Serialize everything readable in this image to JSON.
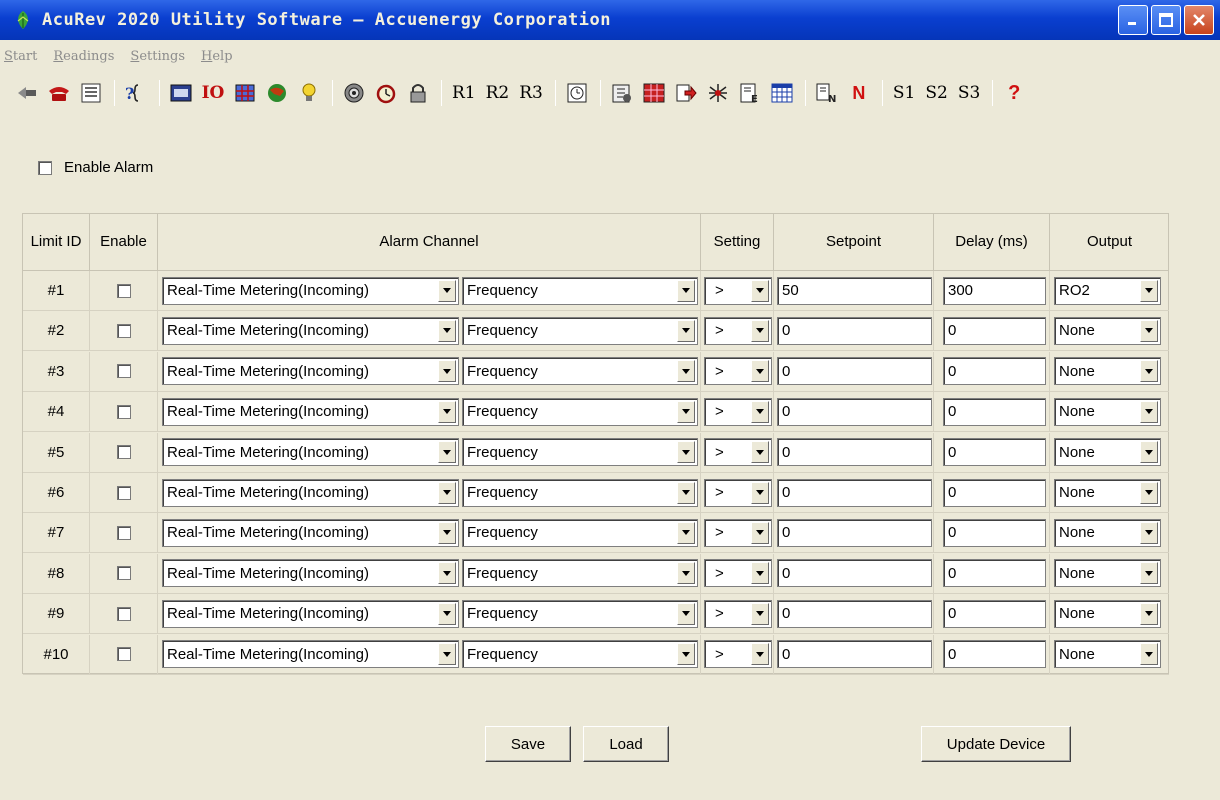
{
  "window": {
    "title": "AcuRev 2020 Utility Software — Accuenergy Corporation",
    "colors": {
      "titlebar": "#0a3fd0",
      "face": "#ece9d8"
    }
  },
  "menu": [
    "Start",
    "Readings",
    "Settings",
    "Help"
  ],
  "toolbar": {
    "icons": [
      "exit-icon",
      "phone-connect-icon",
      "device-info-icon",
      "query-icon",
      "meter-display-icon",
      "io-icon",
      "grid-icon",
      "globe-icon",
      "bulb-icon",
      "target-icon",
      "alarm-clock-icon",
      "lock-icon",
      "r1-icon",
      "r2-icon",
      "r3-icon",
      "clock-icon",
      "tools-icon",
      "table-icon",
      "export-arrow-icon",
      "network-icon",
      "energy-report-icon",
      "calendar-grid-icon",
      "en-icon",
      "n-icon",
      "s1-icon",
      "s2-icon",
      "s3-icon",
      "help-icon"
    ],
    "r_labels": [
      "R1",
      "R2",
      "R3"
    ],
    "s_labels": [
      "S1",
      "S2",
      "S3"
    ],
    "io_label": "IO",
    "n_label": "N",
    "help_label": "?"
  },
  "enable_alarm_label": "Enable Alarm",
  "table": {
    "headers": {
      "limit_id": "Limit ID",
      "enable": "Enable",
      "alarm_channel": "Alarm Channel",
      "setting": "Setting",
      "setpoint": "Setpoint",
      "delay": "Delay (ms)",
      "output": "Output"
    },
    "rows": [
      {
        "id": "#1",
        "channel": "Real-Time Metering(Incoming)",
        "parameter": "Frequency",
        "setting": ">",
        "setpoint": "50",
        "delay": "300",
        "output": "RO2"
      },
      {
        "id": "#2",
        "channel": "Real-Time Metering(Incoming)",
        "parameter": "Frequency",
        "setting": ">",
        "setpoint": "0",
        "delay": "0",
        "output": "None"
      },
      {
        "id": "#3",
        "channel": "Real-Time Metering(Incoming)",
        "parameter": "Frequency",
        "setting": ">",
        "setpoint": "0",
        "delay": "0",
        "output": "None"
      },
      {
        "id": "#4",
        "channel": "Real-Time Metering(Incoming)",
        "parameter": "Frequency",
        "setting": ">",
        "setpoint": "0",
        "delay": "0",
        "output": "None"
      },
      {
        "id": "#5",
        "channel": "Real-Time Metering(Incoming)",
        "parameter": "Frequency",
        "setting": ">",
        "setpoint": "0",
        "delay": "0",
        "output": "None"
      },
      {
        "id": "#6",
        "channel": "Real-Time Metering(Incoming)",
        "parameter": "Frequency",
        "setting": ">",
        "setpoint": "0",
        "delay": "0",
        "output": "None"
      },
      {
        "id": "#7",
        "channel": "Real-Time Metering(Incoming)",
        "parameter": "Frequency",
        "setting": ">",
        "setpoint": "0",
        "delay": "0",
        "output": "None"
      },
      {
        "id": "#8",
        "channel": "Real-Time Metering(Incoming)",
        "parameter": "Frequency",
        "setting": ">",
        "setpoint": "0",
        "delay": "0",
        "output": "None"
      },
      {
        "id": "#9",
        "channel": "Real-Time Metering(Incoming)",
        "parameter": "Frequency",
        "setting": ">",
        "setpoint": "0",
        "delay": "0",
        "output": "None"
      },
      {
        "id": "#10",
        "channel": "Real-Time Metering(Incoming)",
        "parameter": "Frequency",
        "setting": ">",
        "setpoint": "0",
        "delay": "0",
        "output": "None"
      }
    ]
  },
  "buttons": {
    "save": "Save",
    "load": "Load",
    "update": "Update Device"
  }
}
